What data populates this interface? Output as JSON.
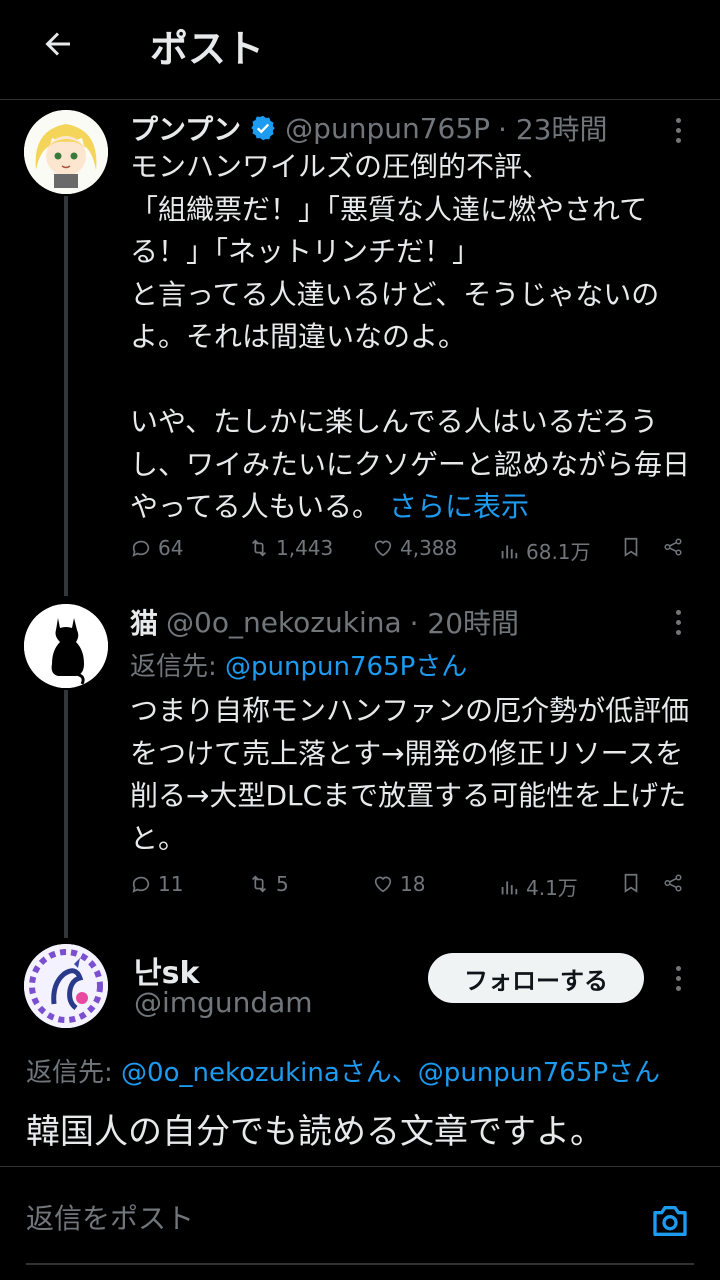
{
  "header": {
    "title": "ポスト"
  },
  "tweets": [
    {
      "name": "プンプン",
      "handle": "@punpun765P",
      "time": "· 23時間",
      "text": "モンハンワイルズの圧倒的不評、\n「組織票だ！」「悪質な人達に燃やされてる！」「ネットリンチだ！」\nと言ってる人達いるけど、そうじゃないのよ。それは間違いなのよ。\n\nいや、たしかに楽しんでる人はいるだろうし、ワイみたいにクソゲーと認めながら毎日やってる人もいる。",
      "show_more": "さらに表示",
      "replies": "64",
      "retweets": "1,443",
      "likes": "4,388",
      "views": "68.1万"
    },
    {
      "name": "猫",
      "handle": "@0o_nekozukina",
      "time": "· 20時間",
      "reply_prefix": "返信先: ",
      "reply_target": "@punpun765Pさん",
      "text": "つまり自称モンハンファンの厄介勢が低評価をつけて売上落とす→開発の修正リソースを削る→大型DLCまで放置する可能性を上げたと。",
      "replies": "11",
      "retweets": "5",
      "likes": "18",
      "views": "4.1万"
    },
    {
      "name": "난sk",
      "handle": "@imgundam",
      "follow_label": "フォローする",
      "reply_prefix": "返信先: ",
      "reply_target": "@0o_nekozukinaさん、@punpun765Pさん",
      "text": "韓国人の自分でも読める文章ですよ。"
    }
  ],
  "composer": {
    "placeholder": "返信をポスト"
  },
  "colors": {
    "accent": "#1d9bf0",
    "verified": "#1d9bf0",
    "muted": "#71767b"
  }
}
